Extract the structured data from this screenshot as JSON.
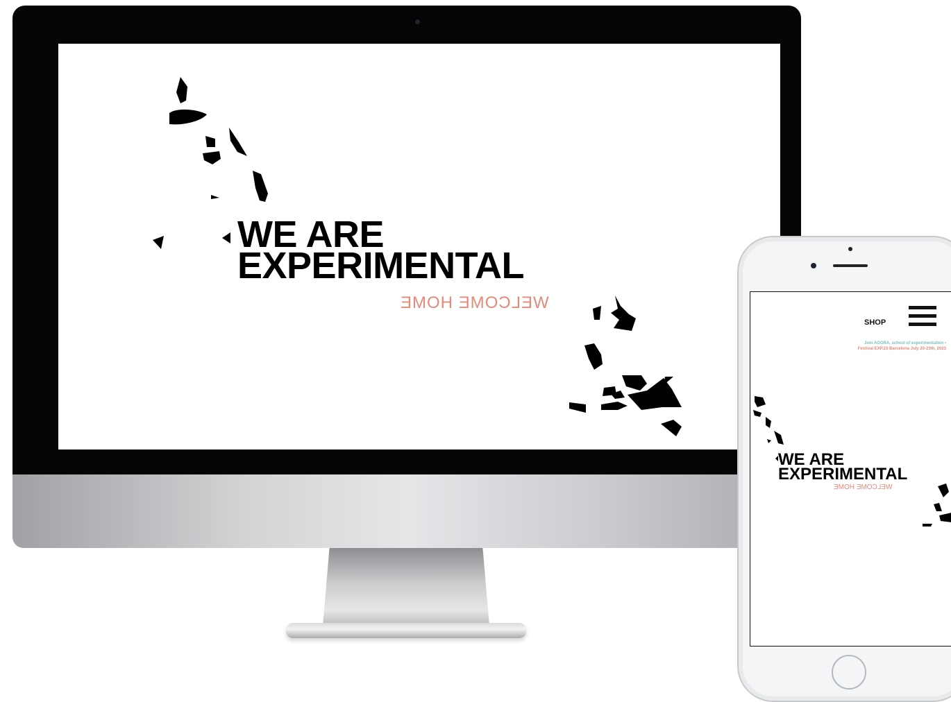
{
  "desktop": {
    "headline": [
      "WE ARE",
      "EXPERIMENTAL"
    ],
    "subheadline": "WELCOME HOME"
  },
  "mobile": {
    "nav": {
      "shop_label": "SHOP",
      "menu_icon": "hamburger-menu-icon"
    },
    "announcement": {
      "line1": "Join AGORA, school of experimentation •",
      "line2": "Festival EXP.23 Barcelona July 20-23th, 2023"
    },
    "headline": [
      "WE ARE",
      "EXPERIMENTAL"
    ],
    "subheadline": "WELCOME HOME"
  },
  "colors": {
    "accent_salmon": "#e58a7a",
    "accent_teal": "#7cc2b9",
    "text": "#000000",
    "background": "#ffffff"
  }
}
